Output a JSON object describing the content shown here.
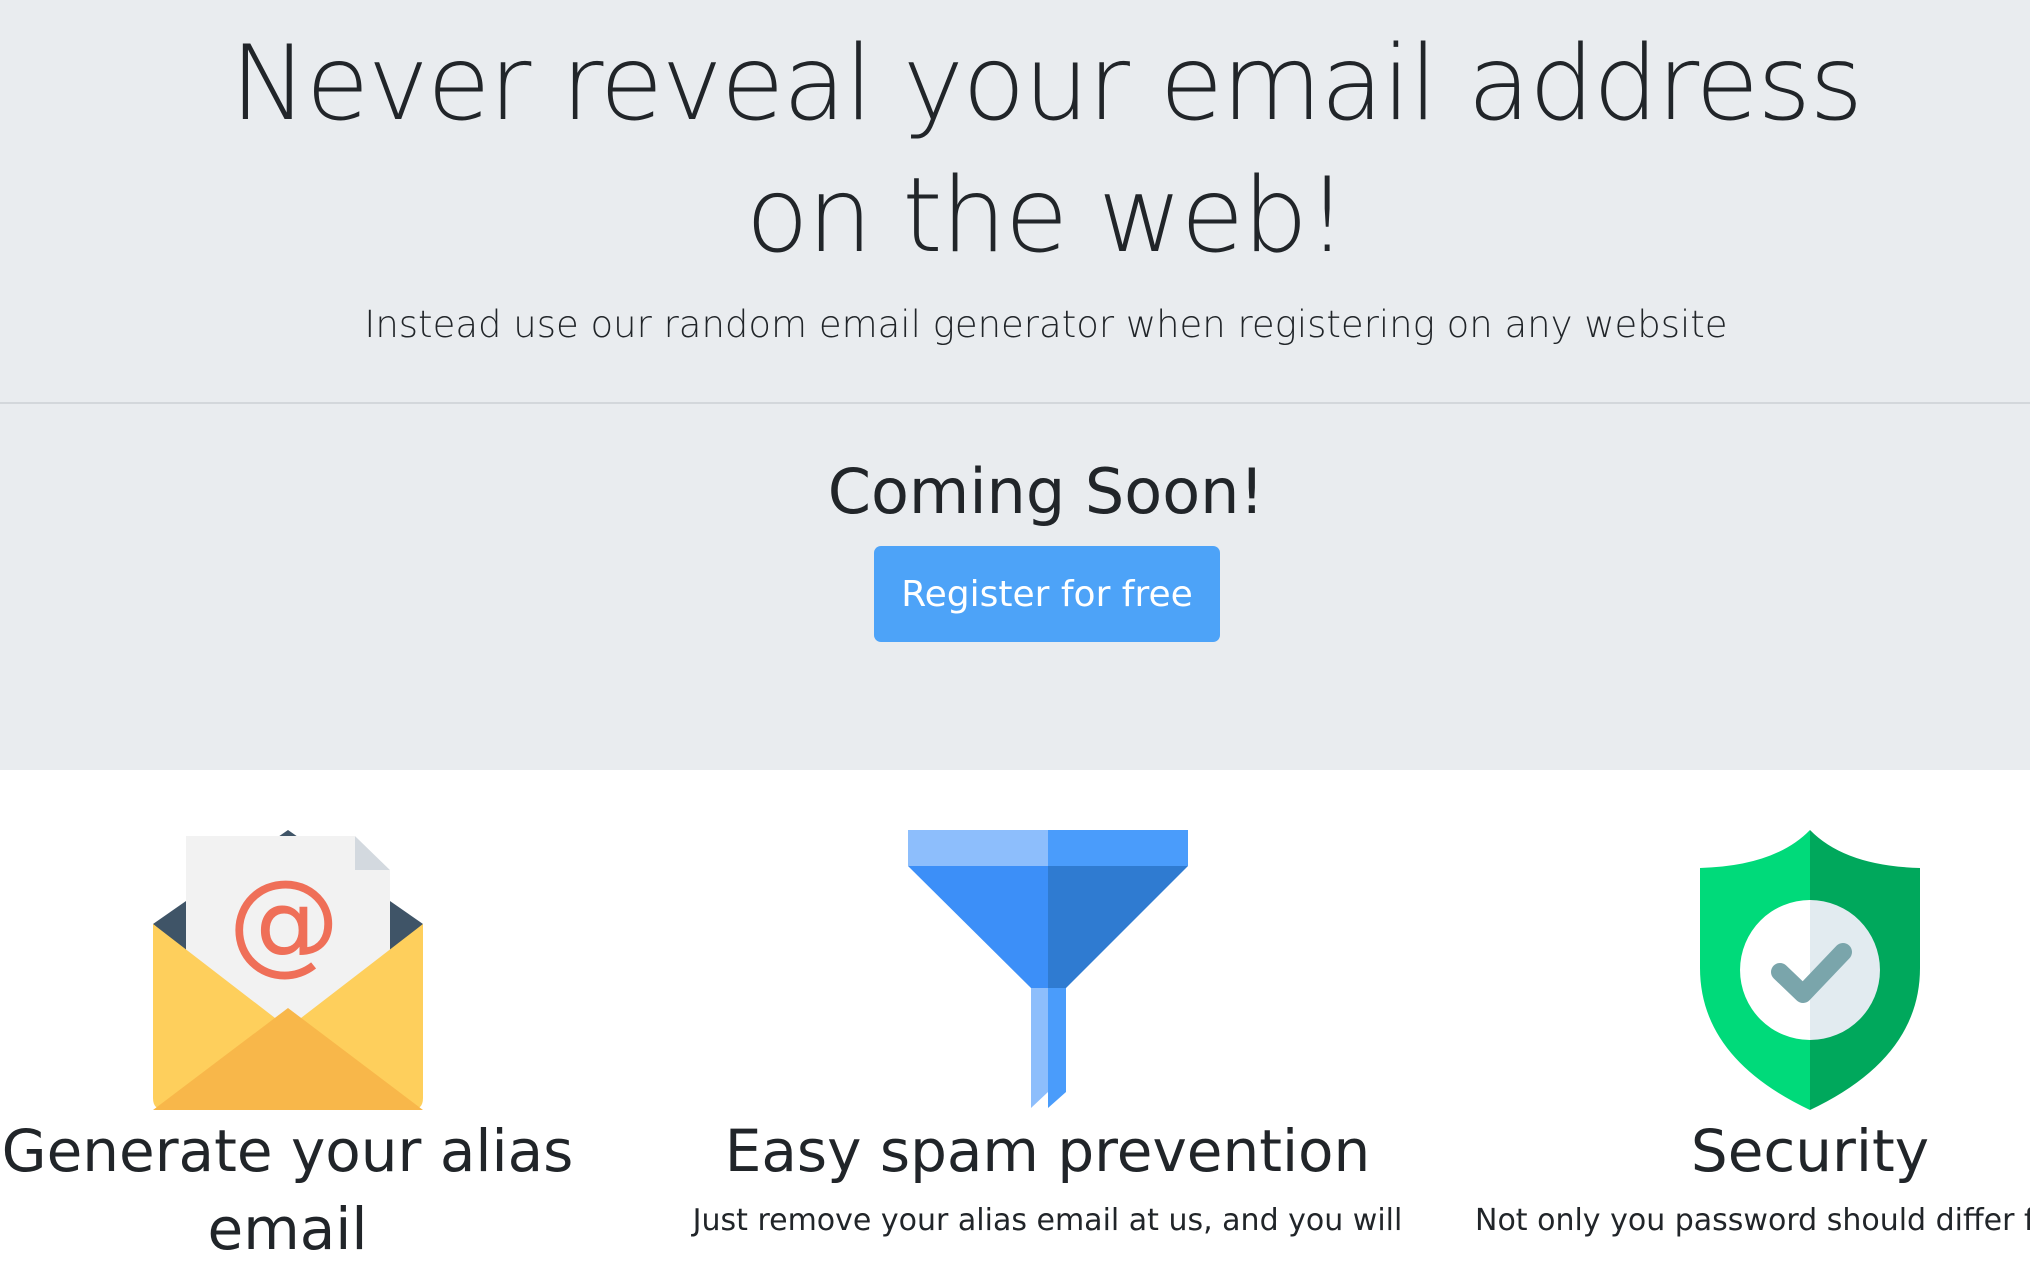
{
  "hero": {
    "title_line1": "Never reveal your email address",
    "title_line2": "on the web!",
    "subtitle": "Instead use our random email generator when registering on any website"
  },
  "signup": {
    "heading": "Coming Soon!",
    "button_label": "Register for free",
    "button_color": "#4da3f8"
  },
  "features": [
    {
      "icon": "envelope-at-icon",
      "title_line1": "Generate your alias",
      "title_line2": "email"
    },
    {
      "icon": "funnel-icon",
      "title": "Easy spam prevention",
      "text": "Just remove your alias email at us, and you will"
    },
    {
      "icon": "shield-check-icon",
      "title": "Security",
      "text": "Not only you password should differ fr"
    }
  ],
  "colors": {
    "hero_background": "#e9ecef",
    "text": "#212529"
  }
}
